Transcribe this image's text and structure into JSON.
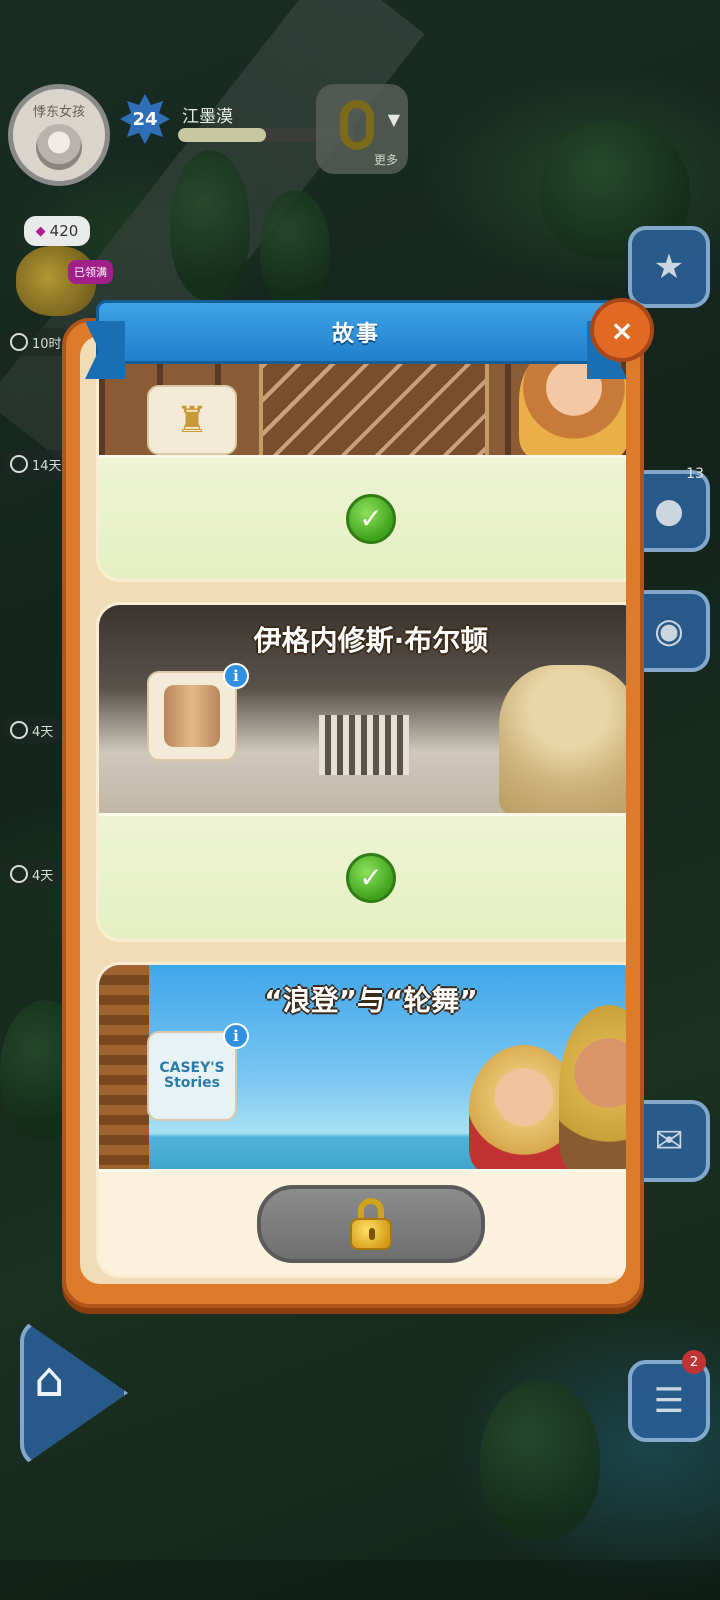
{
  "player": {
    "avatar_text": "悸东女孩",
    "level": "24",
    "name": "江墨漠",
    "xp_fraction": 0.5,
    "more_label": "更多"
  },
  "left_hud": {
    "gems": "420",
    "claimed_label": "已领满",
    "timers": [
      "10时",
      "14天",
      "4天",
      "4天"
    ]
  },
  "right_hud": {
    "profile_badge": "13",
    "tasks_badge": "2"
  },
  "modal": {
    "title": "故事",
    "close_symbol": "×"
  },
  "stories": [
    {
      "title": "",
      "state": "completed",
      "status_symbol": "✓"
    },
    {
      "title": "伊格内修斯·布尔顿",
      "state": "completed",
      "status_symbol": "✓"
    },
    {
      "title": "“浪登”与“轮舞”",
      "state": "locked",
      "thumb_text": "CASEY'S Stories"
    }
  ],
  "icons": {
    "gem": "gem-icon",
    "info": "info-icon",
    "check": "check-icon",
    "lock": "padlock-icon",
    "home": "home-icon"
  },
  "colors": {
    "modal_orange": "#de7b2b",
    "ribbon_blue": "#1f7fcc",
    "check_green": "#3ea21c",
    "lock_grey": "#6f6f6f"
  }
}
